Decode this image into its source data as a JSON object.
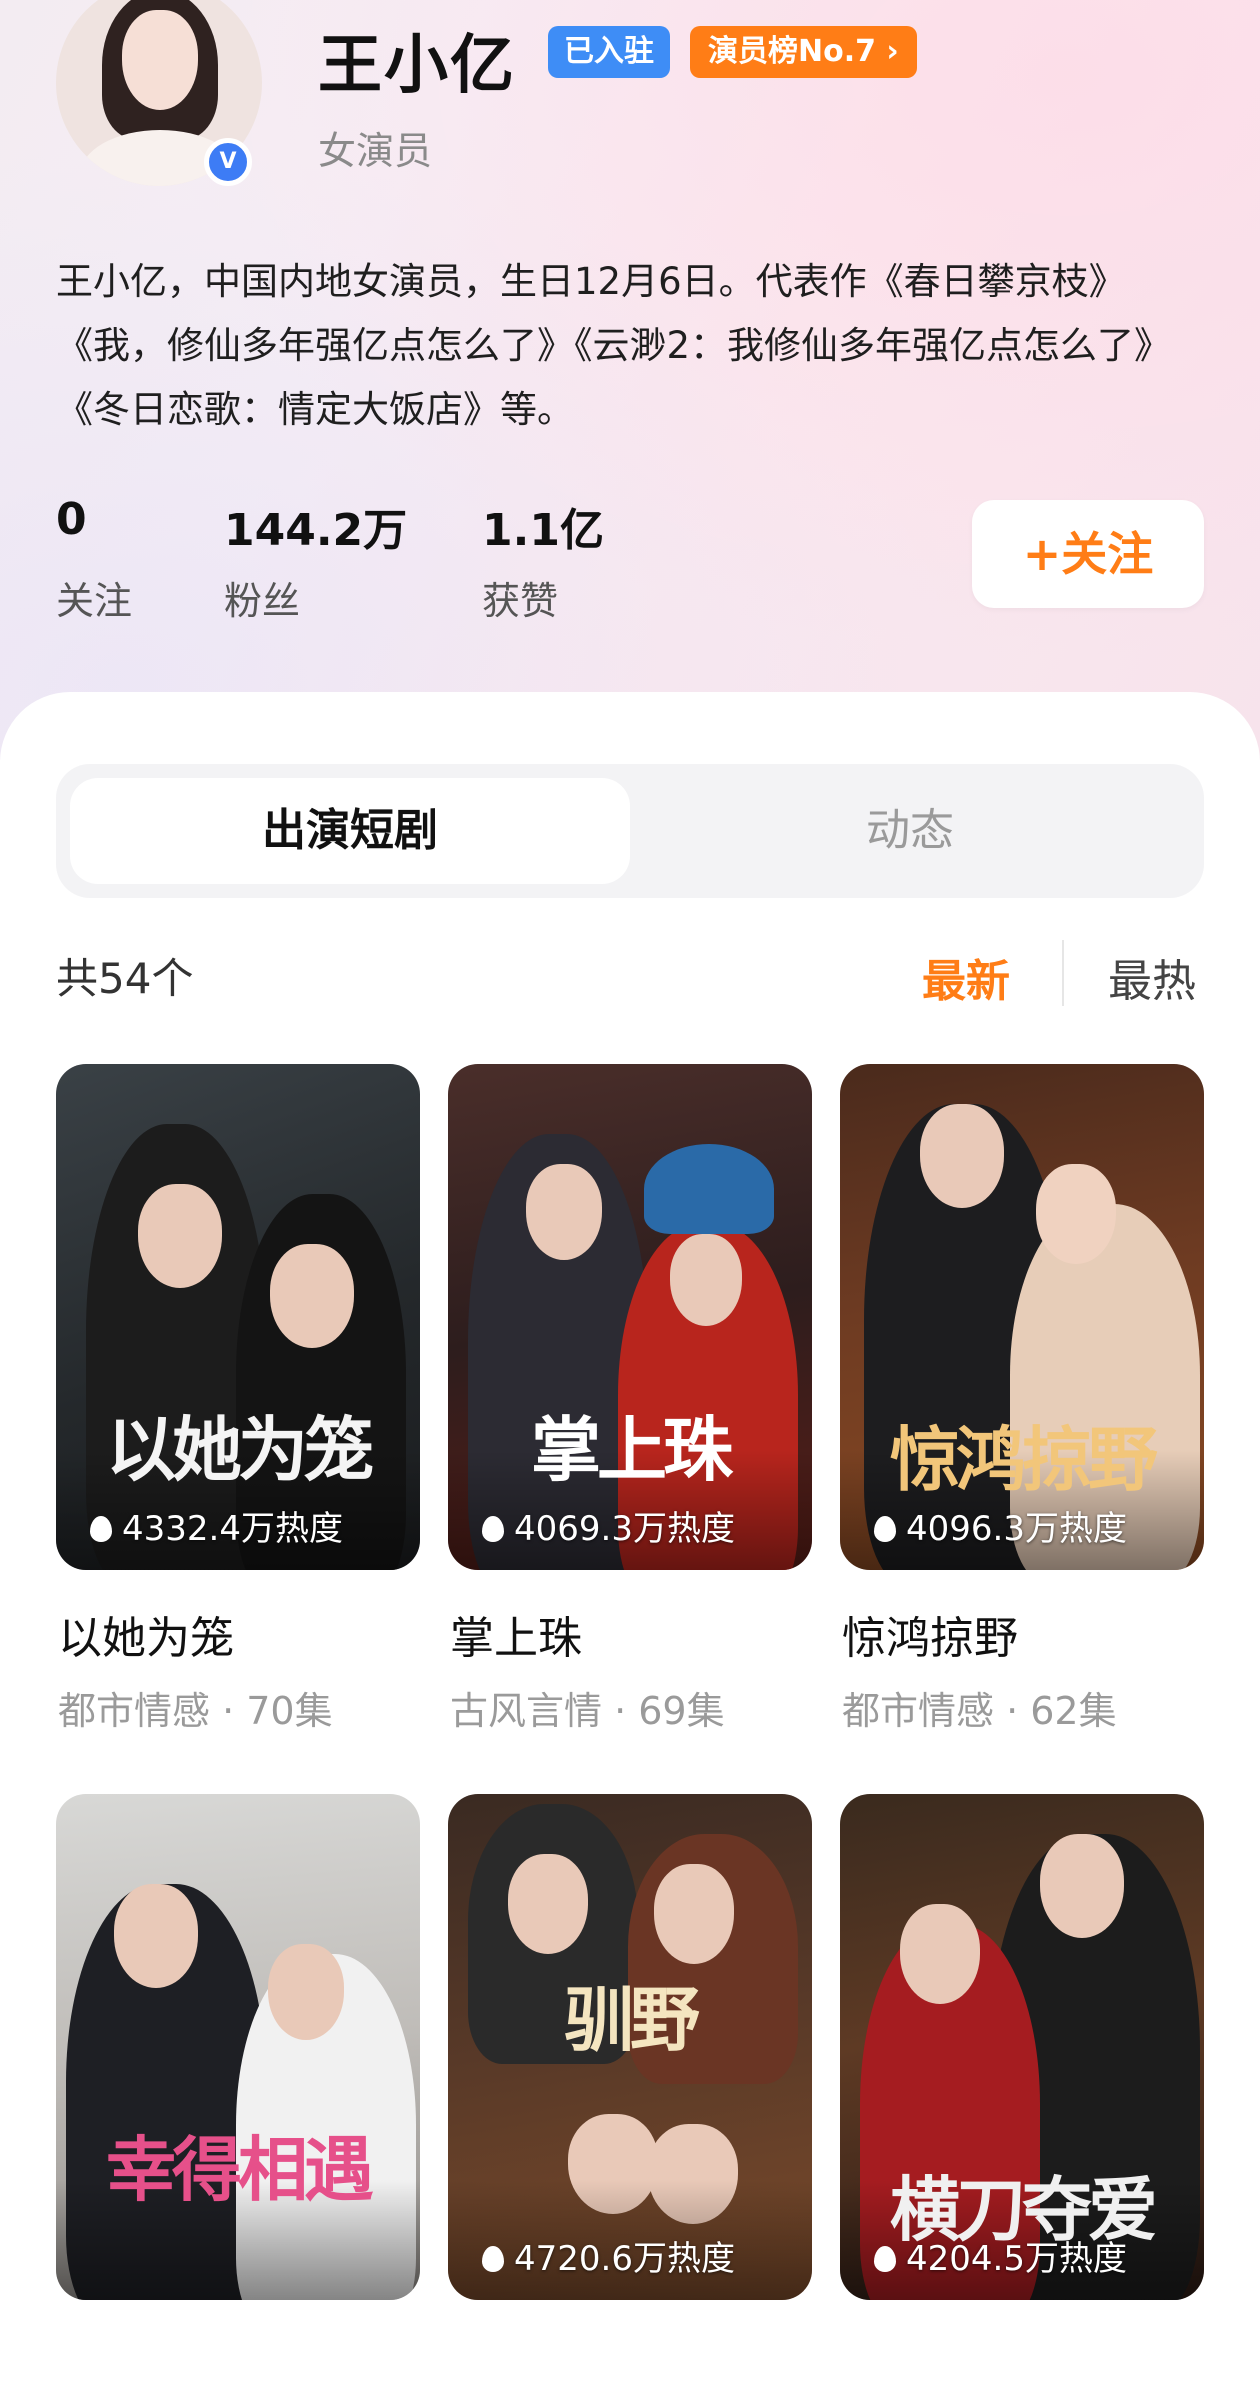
{
  "profile": {
    "name": "王小亿",
    "badge_settled": "已入驻",
    "badge_rank": "演员榜No.7 ›",
    "role": "女演员",
    "verified_mark": "V",
    "bio": "王小亿，中国内地女演员，生日12月6日。代表作《春日攀京枝》《我，修仙多年强亿点怎么了》《云渺2：我修仙多年强亿点怎么了》《冬日恋歌：情定大饭店》等。"
  },
  "stats": [
    {
      "value": "0",
      "label": "关注"
    },
    {
      "value": "144.2万",
      "label": "粉丝"
    },
    {
      "value": "1.1亿",
      "label": "获赞"
    }
  ],
  "follow_button": "+关注",
  "tabs": {
    "active": "出演短剧",
    "inactive": "动态"
  },
  "list": {
    "count": "共54个",
    "sort_new": "最新",
    "sort_hot": "最热"
  },
  "dramas": [
    {
      "title": "以她为笼",
      "poster_text": "以她为笼",
      "heat": "4332.4万热度",
      "meta": "都市情感 · 70集"
    },
    {
      "title": "掌上珠",
      "poster_text": "掌上珠",
      "heat": "4069.3万热度",
      "meta": "古风言情 · 69集"
    },
    {
      "title": "惊鸿掠野",
      "poster_text": "惊鸿掠野",
      "heat": "4096.3万热度",
      "meta": "都市情感 · 62集"
    },
    {
      "title": "",
      "poster_text": "幸得相遇",
      "heat": "",
      "meta": ""
    },
    {
      "title": "",
      "poster_text": "驯野",
      "heat": "4720.6万热度",
      "meta": ""
    },
    {
      "title": "",
      "poster_text": "横刀夺爱",
      "heat": "4204.5万热度",
      "meta": ""
    }
  ],
  "colors": {
    "accent": "#ff7d16",
    "badge_blue": "#3e8df6",
    "text_primary": "#111111",
    "text_secondary": "#9a9a9a"
  }
}
